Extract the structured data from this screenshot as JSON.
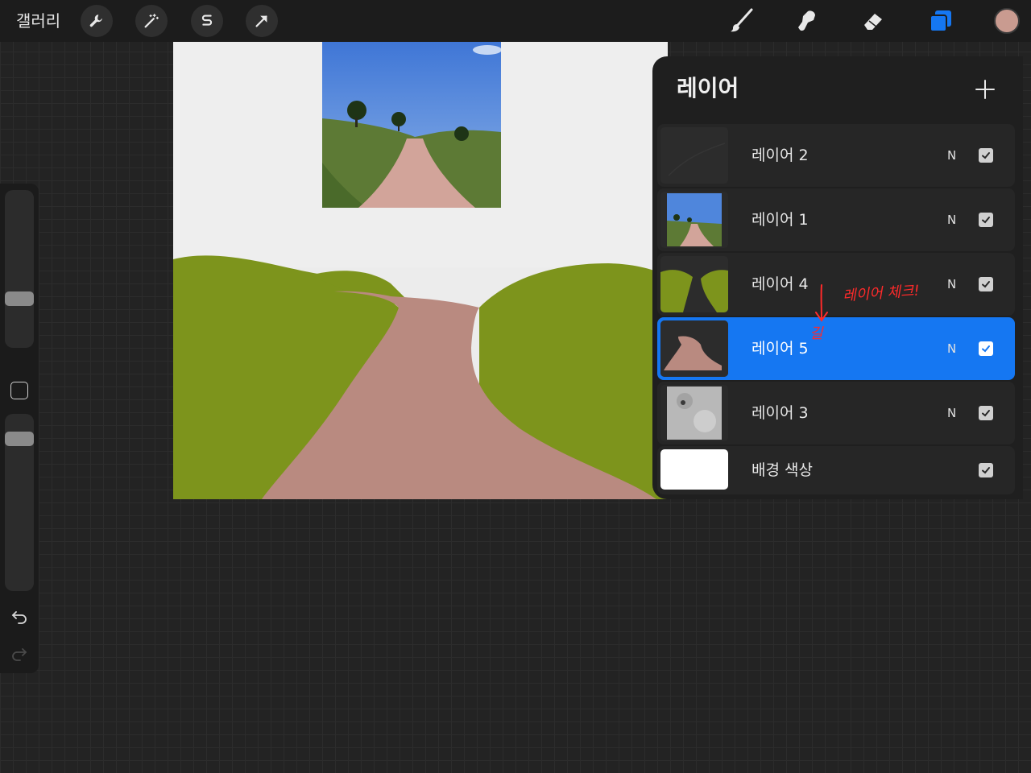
{
  "topbar": {
    "gallery_label": "갤러리",
    "left_tools": [
      "wrench-icon",
      "magic-wand-icon",
      "selection-icon",
      "transform-arrow-icon"
    ],
    "right_tools": [
      "brush-icon",
      "smudge-icon",
      "eraser-icon",
      "layers-icon"
    ],
    "active_color": "#c99b90",
    "accent": "#1577f2"
  },
  "layers_panel": {
    "title": "레이어",
    "add_icon": "plus-icon",
    "layers": [
      {
        "name": "레이어 2",
        "blend": "N",
        "visible": true,
        "selected": false
      },
      {
        "name": "레이어 1",
        "blend": "N",
        "visible": true,
        "selected": false
      },
      {
        "name": "레이어 4",
        "blend": "N",
        "visible": true,
        "selected": false
      },
      {
        "name": "레이어 5",
        "blend": "N",
        "visible": true,
        "selected": true
      },
      {
        "name": "레이어 3",
        "blend": "N",
        "visible": true,
        "selected": false
      },
      {
        "name": "배경 색상",
        "blend": "",
        "visible": true,
        "selected": false
      }
    ]
  },
  "annotation": {
    "text": "레이어 체크!",
    "small_text": "길",
    "color": "#ff2a2a"
  }
}
